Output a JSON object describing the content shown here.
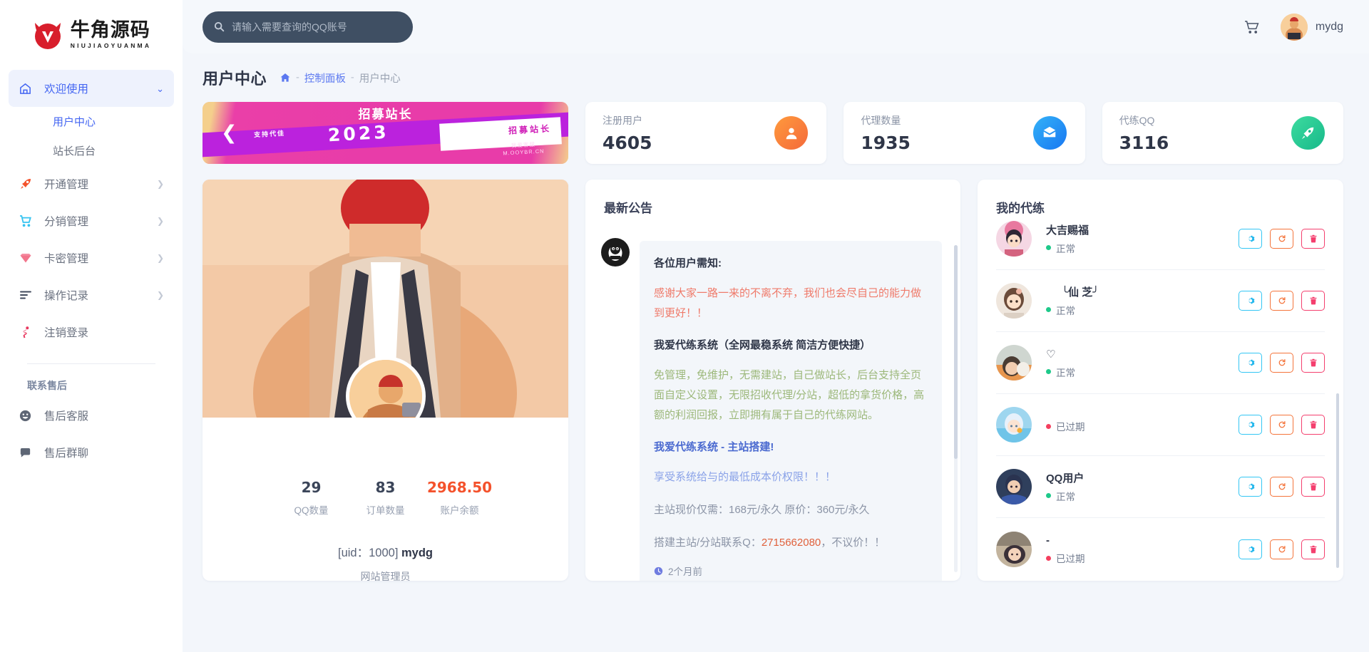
{
  "brand": {
    "name_cn": "牛角源码",
    "name_en": "NIUJIAOYUANMA"
  },
  "search": {
    "placeholder": "请输入需要查询的QQ账号",
    "value": "",
    "icon": "search-icon"
  },
  "topbar": {
    "cart_icon": "cart-icon",
    "username": "mydg"
  },
  "sidebar": {
    "items": [
      {
        "label": "欢迎使用",
        "icon": "home-icon",
        "active": true,
        "expanded": true,
        "chevron": "chevron-down-icon"
      },
      {
        "label": "开通管理",
        "icon": "rocket-icon",
        "chevron": "chevron-right-icon"
      },
      {
        "label": "分销管理",
        "icon": "cart-icon",
        "chevron": "chevron-right-icon"
      },
      {
        "label": "卡密管理",
        "icon": "gem-icon",
        "chevron": "chevron-right-icon"
      },
      {
        "label": "操作记录",
        "icon": "list-icon",
        "chevron": "chevron-right-icon"
      },
      {
        "label": "注销登录",
        "icon": "runner-icon",
        "chevron": ""
      }
    ],
    "subitems": [
      {
        "label": "用户中心",
        "active": true
      },
      {
        "label": "站长后台",
        "active": false
      }
    ],
    "section_title": "联系售后",
    "support": [
      {
        "label": "售后客服",
        "icon": "smiley-icon"
      },
      {
        "label": "售后群聊",
        "icon": "chat-icon"
      }
    ]
  },
  "page": {
    "title": "用户中心",
    "breadcrumb": {
      "home_icon": "home-icon",
      "sep": "-",
      "link": "控制面板",
      "current": "用户中心"
    }
  },
  "banner": {
    "top_title": "招募站长",
    "year": "2023",
    "left_text": "支持代佳",
    "white_text": "招募站长",
    "url_line1": "我爱客服",
    "url_line2": "M.OOYBR.CN",
    "arrow_left": "chevron-left-icon",
    "arrow_right": "chevron-right-icon"
  },
  "stats": [
    {
      "label": "注册用户",
      "value": "4605",
      "icon": "user-icon",
      "color": "#f4693b"
    },
    {
      "label": "代理数量",
      "value": "1935",
      "icon": "envelope-icon",
      "color": "#1877f2"
    },
    {
      "label": "代练QQ",
      "value": "3116",
      "icon": "rocket-icon",
      "color": "#17b98a"
    }
  ],
  "profile": {
    "stats": [
      {
        "value": "29",
        "label": "QQ数量"
      },
      {
        "value": "83",
        "label": "订单数量"
      },
      {
        "value": "2968.50",
        "label": "账户余额",
        "accent": "#f4522c"
      }
    ],
    "uid_prefix": "[uid：",
    "uid": "1000",
    "uid_suffix": "]",
    "username": "mydg",
    "role": "网站管理员"
  },
  "notice": {
    "title": "最新公告",
    "avatar_icon": "qq-penguin-icon",
    "lines": [
      {
        "text": "各位用户需知:",
        "style": "bold-dark"
      },
      {
        "text": "感谢大家一路一来的不离不弃，我们也会尽自己的能力做到更好！！",
        "style": "red"
      },
      {
        "text": "我爱代练系统（全网最稳系统 简洁方便快捷）",
        "style": "bold-dark"
      },
      {
        "text": "免管理，免维护，无需建站，自己做站长，后台支持全页面自定义设置，无限招收代理/分站，超低的拿货价格，高额的利润回报，立即拥有属于自己的代练网站。",
        "style": "green"
      },
      {
        "text": "我爱代练系统 - 主站搭建!",
        "style": "blue"
      },
      {
        "text": "享受系统给与的最低成本价权限！！！",
        "style": "lblue"
      },
      {
        "text": "主站现价仅需：168元/永久  原价：360元/永久",
        "style": "gray"
      },
      {
        "text": "搭建主站/分站联系Q：",
        "style": "gray",
        "suffix": "2715662080",
        "suffix_style": "orange",
        "tail": "，不议价！！"
      }
    ],
    "time_icon": "clock-icon",
    "time": "2个月前"
  },
  "agents": {
    "title": "我的代练",
    "actions": [
      {
        "name": "config",
        "icon": "gear-icon",
        "color": "#1fb6ec"
      },
      {
        "name": "renew",
        "icon": "refresh-icon",
        "color": "#f4743b"
      },
      {
        "name": "delete",
        "icon": "trash-icon",
        "color": "#f43f6e"
      }
    ],
    "rows": [
      {
        "name": "大吉赐福",
        "status": "正常",
        "status_type": "ok",
        "avatar": "anime-girl-umbrella"
      },
      {
        "name": "╰仙 芝╯",
        "status": "正常",
        "status_type": "ok",
        "avatar": "anime-girl-hanfu"
      },
      {
        "name": "♡",
        "status": "正常",
        "status_type": "ok",
        "avatar": "photo-cat"
      },
      {
        "name": "",
        "status": "已过期",
        "status_type": "expired",
        "avatar": "anime-blue-girl"
      },
      {
        "name": "QQ用户",
        "status": "正常",
        "status_type": "ok",
        "avatar": "photo-boy"
      },
      {
        "name": "-",
        "status": "已过期",
        "status_type": "expired",
        "avatar": "photo-girl"
      }
    ]
  }
}
